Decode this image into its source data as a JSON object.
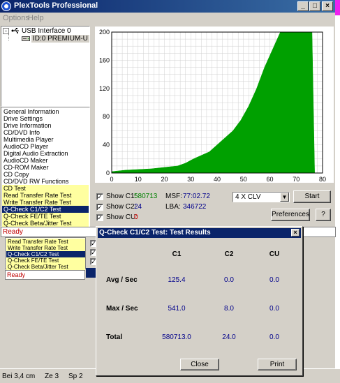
{
  "window": {
    "title": "PlexTools Professional",
    "min_glyph": "_",
    "max_glyph": "□",
    "close_glyph": "×"
  },
  "menu": [
    "Options",
    "Help"
  ],
  "tree": {
    "root": "USB Interface 0",
    "expander": "-",
    "drive": "ID:0  PREMIUM-U"
  },
  "functions": [
    {
      "label": "General Information",
      "style": "plain"
    },
    {
      "label": "Drive Settings",
      "style": "plain"
    },
    {
      "label": "Drive Information",
      "style": "plain"
    },
    {
      "label": "CD/DVD Info",
      "style": "plain"
    },
    {
      "label": "Multimedia Player",
      "style": "plain"
    },
    {
      "label": "AudioCD Player",
      "style": "plain"
    },
    {
      "label": "Digital Audio Extraction",
      "style": "plain"
    },
    {
      "label": "AudioCD Maker",
      "style": "plain"
    },
    {
      "label": "CD-ROM Maker",
      "style": "plain"
    },
    {
      "label": "CD Copy",
      "style": "plain"
    },
    {
      "label": "CD/DVD RW Functions",
      "style": "plain"
    },
    {
      "label": "CD Test",
      "style": "yellow"
    },
    {
      "label": "Read Transfer Rate Test",
      "style": "yellow"
    },
    {
      "label": "Write Transfer Rate Test",
      "style": "yellow"
    },
    {
      "label": "Q-Check C1/C2 Test",
      "style": "selected"
    },
    {
      "label": "Q-Check FE/TE Test",
      "style": "yellow"
    },
    {
      "label": "Q-Check Beta/Jitter Test",
      "style": "yellow"
    }
  ],
  "status": "Ready",
  "chart_data": {
    "type": "area",
    "xlabel": "",
    "ylabel": "",
    "xlim": [
      0,
      80
    ],
    "ylim": [
      0,
      200
    ],
    "xticks": [
      0,
      10,
      20,
      30,
      40,
      50,
      60,
      70,
      80
    ],
    "yticks": [
      0,
      40,
      80,
      120,
      160,
      200
    ],
    "grid": true,
    "series": [
      {
        "color": "#00a000",
        "x": [
          0,
          5,
          10,
          15,
          20,
          25,
          28,
          31,
          34,
          37,
          40,
          43,
          46,
          49,
          52,
          55,
          58,
          61,
          64,
          67,
          70,
          73,
          76,
          77
        ],
        "y": [
          2,
          4,
          5,
          6,
          8,
          10,
          14,
          20,
          25,
          30,
          40,
          50,
          60,
          75,
          95,
          120,
          150,
          175,
          200,
          200,
          200,
          200,
          200,
          0
        ]
      }
    ]
  },
  "controls": {
    "show_c1_label": "Show C1:",
    "show_c1_value": "580713",
    "show_c2_label": "Show C2:",
    "show_c2_value": "24",
    "show_cu_label": "Show CU:",
    "show_cu_value": "0",
    "msf_label": "MSF:",
    "msf_value": "77:02.72",
    "lba_label": "LBA:",
    "lba_value": "346722",
    "speed": "4 X CLV",
    "start": "Start",
    "preferences": "Preferences",
    "help": "?",
    "check": "✓"
  },
  "background_window": {
    "items": [
      "Read Transfer Rate Test",
      "Write Transfer Rate Test",
      "Q-Check C1/C2 Test",
      "Q-Check FE/TE Test",
      "Q-Check Beta/Jitter Test"
    ],
    "status": "Ready"
  },
  "dialog": {
    "title": "Q-Check C1/C2 Test: Test Results",
    "col_c1": "C1",
    "col_c2": "C2",
    "col_cu": "CU",
    "rows": [
      {
        "label": "Avg / Sec",
        "c1": "125.4",
        "c2": "0.0",
        "cu": "0.0"
      },
      {
        "label": "Max / Sec",
        "c1": "541.0",
        "c2": "8.0",
        "cu": "0.0"
      },
      {
        "label": "Total",
        "c1": "580713.0",
        "c2": "24.0",
        "cu": "0.0"
      }
    ],
    "close": "Close",
    "print": "Print"
  },
  "bottom_status": {
    "pos": "Bei 3,4 cm",
    "line": "Ze 3",
    "col": "Sp 2"
  }
}
